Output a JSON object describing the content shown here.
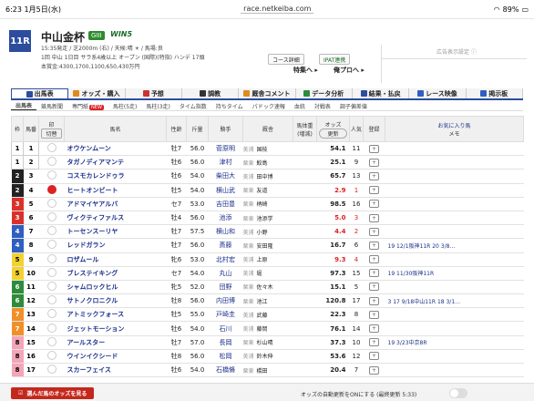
{
  "status": {
    "time": "6:23",
    "date": "1月5日(水)",
    "url": "race.netkeiba.com",
    "battery": "89%"
  },
  "race": {
    "badge": "11R",
    "title": "中山金杯",
    "grade": "GIII",
    "win5": "WIN5",
    "line1": "15:35発走 / 芝2000m (右) / 天候:晴 ☀ / 馬場:良",
    "line2": "1回 中山 1日目 サラ系4歳以上 オープン (国際)(特指) ハンデ 17頭",
    "line3": "本賞金:4300,1700,1100,650,430万円"
  },
  "header_buttons": {
    "course": "コース詳細",
    "ipat": "IPAT連携",
    "special": "特集へ ▸",
    "oreplus": "俺プロへ ▸"
  },
  "ad_label": "広告表示設定 ⓘ",
  "tabs": [
    "出馬表",
    "オッズ・購入",
    "予想",
    "調教",
    "厩舎コメント",
    "データ分析",
    "結果・払戻",
    "レース映像",
    "掲示板"
  ],
  "subtabs": [
    "出馬表",
    "競馬新聞",
    "専門紙",
    "馬柱(5走)",
    "馬柱(3走)",
    "タイム指数",
    "持ちタイム",
    "パドック速報",
    "血統",
    "対戦表",
    "調子偏差値"
  ],
  "subtab_new": "NEW",
  "columns": {
    "waku": "枠",
    "umaban": "馬番",
    "mark": "印",
    "mark_sub": "切替",
    "horse": "馬名",
    "sex_age": "性齢",
    "weight": "斤量",
    "jockey": "騎手",
    "trainer": "厩舎",
    "body": "馬体重",
    "body_sub": "(増減)",
    "odds": "オッズ",
    "odds_sub": "更新",
    "pop": "人気",
    "reg": "登録",
    "fav": "お気に入り馬",
    "memo": "メモ"
  },
  "horses": [
    {
      "w": "1",
      "n": "1",
      "name": "オウケンムーン",
      "sa": "牡7",
      "kg": "56.0",
      "jockey": "菅原明",
      "area": "美浦",
      "trainer": "国枝",
      "odds": "54.1",
      "pop": "11",
      "note": ""
    },
    {
      "w": "1",
      "n": "2",
      "name": "タガノディアマンテ",
      "sa": "牡6",
      "kg": "56.0",
      "jockey": "津村",
      "area": "栗東",
      "trainer": "鮫島",
      "odds": "25.1",
      "pop": "9",
      "note": ""
    },
    {
      "w": "2",
      "n": "3",
      "name": "コスモカレンドゥラ",
      "sa": "牡6",
      "kg": "54.0",
      "jockey": "柴田大",
      "area": "美浦",
      "trainer": "田中博",
      "odds": "65.7",
      "pop": "13",
      "note": ""
    },
    {
      "w": "2",
      "n": "4",
      "name": "ヒートオンビート",
      "sa": "牡5",
      "kg": "54.0",
      "jockey": "横山武",
      "area": "栗東",
      "trainer": "友道",
      "odds": "2.9",
      "pop": "1",
      "note": "",
      "hot": true
    },
    {
      "w": "3",
      "n": "5",
      "name": "アドマイヤアルバ",
      "sa": "セ7",
      "kg": "53.0",
      "jockey": "吉田豊",
      "area": "栗東",
      "trainer": "柄崎",
      "odds": "98.5",
      "pop": "16",
      "note": ""
    },
    {
      "w": "3",
      "n": "6",
      "name": "ヴィクティファルス",
      "sa": "牡4",
      "kg": "56.0",
      "jockey": "池添",
      "area": "栗東",
      "trainer": "池添学",
      "odds": "5.0",
      "pop": "3",
      "note": "",
      "hot": true
    },
    {
      "w": "4",
      "n": "7",
      "name": "トーセンスーリヤ",
      "sa": "牡7",
      "kg": "57.5",
      "jockey": "横山和",
      "area": "美浦",
      "trainer": "小野",
      "odds": "4.4",
      "pop": "2",
      "note": "",
      "hot": true
    },
    {
      "w": "4",
      "n": "8",
      "name": "レッドガラン",
      "sa": "牡7",
      "kg": "56.0",
      "jockey": "斎藤",
      "area": "栗東",
      "trainer": "安田隆",
      "odds": "16.7",
      "pop": "6",
      "note": "19 12/1阪神11R 20 3/8…"
    },
    {
      "w": "5",
      "n": "9",
      "name": "ロザムール",
      "sa": "牝6",
      "kg": "53.0",
      "jockey": "北村宏",
      "area": "美浦",
      "trainer": "上原",
      "odds": "9.3",
      "pop": "4",
      "note": "",
      "hot": true
    },
    {
      "w": "5",
      "n": "10",
      "name": "ブレステイキング",
      "sa": "セ7",
      "kg": "54.0",
      "jockey": "丸山",
      "area": "美浦",
      "trainer": "堀",
      "odds": "97.3",
      "pop": "15",
      "note": "19 11/30阪神11R"
    },
    {
      "w": "6",
      "n": "11",
      "name": "シャムロックヒル",
      "sa": "牝5",
      "kg": "52.0",
      "jockey": "団野",
      "area": "栗東",
      "trainer": "佐々木",
      "odds": "15.1",
      "pop": "5",
      "note": ""
    },
    {
      "w": "6",
      "n": "12",
      "name": "サトノクロニクル",
      "sa": "牡8",
      "kg": "56.0",
      "jockey": "内田博",
      "area": "栗東",
      "trainer": "池江",
      "odds": "120.8",
      "pop": "17",
      "note": "3 17 9/18中山11R 18 3/1…"
    },
    {
      "w": "7",
      "n": "13",
      "name": "アトミックフォース",
      "sa": "牡5",
      "kg": "55.0",
      "jockey": "戸崎圭",
      "area": "美浦",
      "trainer": "武藤",
      "odds": "22.3",
      "pop": "8",
      "note": ""
    },
    {
      "w": "7",
      "n": "14",
      "name": "ジェットモーション",
      "sa": "牡6",
      "kg": "54.0",
      "jockey": "石川",
      "area": "美浦",
      "trainer": "藤岡",
      "odds": "76.1",
      "pop": "14",
      "note": ""
    },
    {
      "w": "8",
      "n": "15",
      "name": "アールスター",
      "sa": "牡7",
      "kg": "57.0",
      "jockey": "長岡",
      "area": "栗東",
      "trainer": "杉山晴",
      "odds": "37.3",
      "pop": "10",
      "note": "19 3/23中京8R"
    },
    {
      "w": "8",
      "n": "16",
      "name": "ウインイクシード",
      "sa": "牡8",
      "kg": "56.0",
      "jockey": "松岡",
      "area": "美浦",
      "trainer": "鈴木伸",
      "odds": "53.6",
      "pop": "12",
      "note": ""
    },
    {
      "w": "8",
      "n": "17",
      "name": "スカーフェイス",
      "sa": "牡6",
      "kg": "54.0",
      "jockey": "石橋脩",
      "area": "栗東",
      "trainer": "橋田",
      "odds": "20.4",
      "pop": "7",
      "note": ""
    }
  ],
  "bottom": {
    "button": "選んだ馬のオッズを見る",
    "auto_text": "オッズの自動更新をONにする (最終更新 5:33)"
  },
  "colors": {
    "accent": "#2c4d9e",
    "hot": "#d22"
  }
}
